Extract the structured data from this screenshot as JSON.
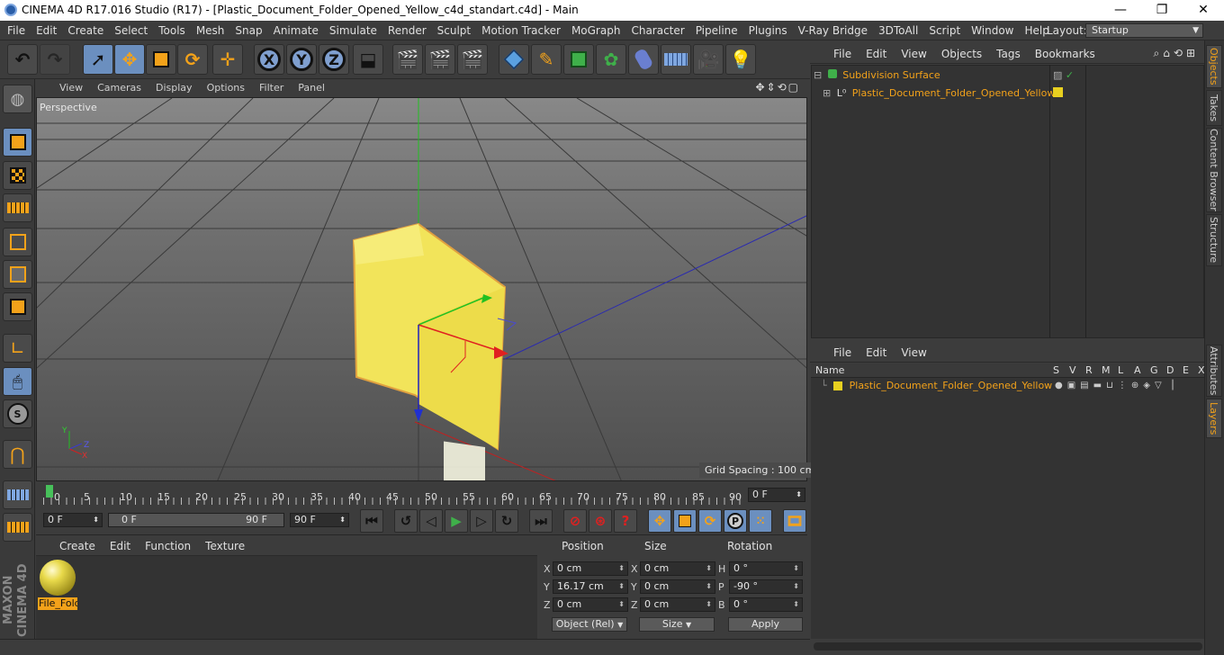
{
  "window": {
    "title": "CINEMA 4D R17.016 Studio (R17) - [Plastic_Document_Folder_Opened_Yellow_c4d_standart.c4d] - Main",
    "minimize": "—",
    "maximize": "❐",
    "close": "✕"
  },
  "menubar": {
    "items": [
      "File",
      "Edit",
      "Create",
      "Select",
      "Tools",
      "Mesh",
      "Snap",
      "Animate",
      "Simulate",
      "Render",
      "Sculpt",
      "Motion Tracker",
      "MoGraph",
      "Character",
      "Pipeline",
      "Plugins",
      "V-Ray Bridge",
      "3DToAll",
      "Script",
      "Window",
      "Help"
    ],
    "layout_label": "Layout:",
    "layout_value": "Startup"
  },
  "toolbar": {
    "x_axis": "X",
    "y_axis": "Y",
    "z_axis": "Z"
  },
  "viewport": {
    "menu": [
      "View",
      "Cameras",
      "Display",
      "Options",
      "Filter",
      "Panel"
    ],
    "label": "Perspective",
    "grid_spacing": "Grid Spacing : 100 cm",
    "axis_y": "Y",
    "axis_z": "Z",
    "axis_x": "X"
  },
  "timeline": {
    "ticks": [
      "0",
      "5",
      "10",
      "15",
      "20",
      "25",
      "30",
      "35",
      "40",
      "45",
      "50",
      "55",
      "60",
      "65",
      "70",
      "75",
      "80",
      "85",
      "90"
    ],
    "current_frame": "0 F",
    "start_frame": "0 F",
    "range_start": "0 F",
    "range_end": "90 F",
    "end_frame": "90 F"
  },
  "material_manager": {
    "menu": [
      "Create",
      "Edit",
      "Function",
      "Texture"
    ],
    "material_name": "File_Fold"
  },
  "coordinates": {
    "headers": {
      "position": "Position",
      "size": "Size",
      "rotation": "Rotation"
    },
    "rows": [
      {
        "label": "X",
        "pos": "0 cm",
        "size_label": "X",
        "size": "0 cm",
        "rot_label": "H",
        "rot": "0 °"
      },
      {
        "label": "Y",
        "pos": "16.17 cm",
        "size_label": "Y",
        "size": "0 cm",
        "rot_label": "P",
        "rot": "-90 °"
      },
      {
        "label": "Z",
        "pos": "0 cm",
        "size_label": "Z",
        "size": "0 cm",
        "rot_label": "B",
        "rot": "0 °"
      }
    ],
    "mode": "Object (Rel)",
    "size_mode": "Size",
    "apply": "Apply"
  },
  "object_manager": {
    "menu": [
      "File",
      "Edit",
      "View",
      "Objects",
      "Tags",
      "Bookmarks"
    ],
    "objects": [
      {
        "name": "Subdivision Surface"
      },
      {
        "name": "Plastic_Document_Folder_Opened_Yellow"
      }
    ]
  },
  "layer_manager": {
    "menu": [
      "File",
      "Edit",
      "View"
    ],
    "columns": [
      "Name",
      "S",
      "V",
      "R",
      "M",
      "L",
      "A",
      "G",
      "D",
      "E",
      "X"
    ],
    "layers": [
      {
        "name": "Plastic_Document_Folder_Opened_Yellow",
        "color": "#e8d020"
      }
    ]
  },
  "side_tabs": [
    "Objects",
    "Takes",
    "Content Browser",
    "Structure",
    "Attributes",
    "Layers"
  ],
  "colors": {
    "accent_orange": "#f3a21a",
    "selected_blue": "#6b8fbf",
    "folder_yellow": "#f2e45a"
  }
}
